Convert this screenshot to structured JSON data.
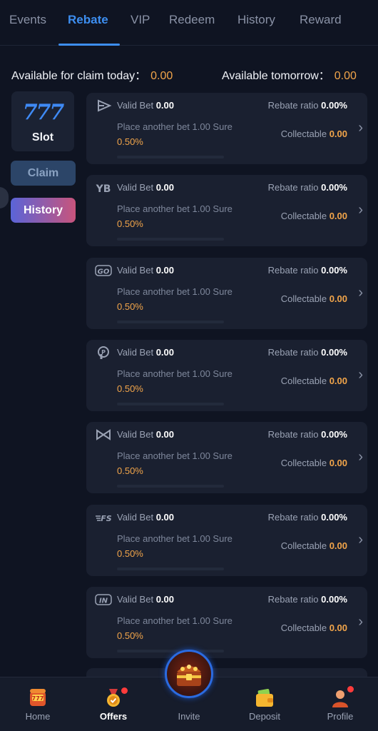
{
  "tabs": [
    "Events",
    "Rebate",
    "VIP",
    "Redeem",
    "History",
    "Reward"
  ],
  "available": {
    "today_label": "Available for claim today：",
    "today_value": "0.00",
    "tomorrow_label": "Available tomorrow：",
    "tomorrow_value": "0.00"
  },
  "category": {
    "logo": "777",
    "label": "Slot"
  },
  "buttons": {
    "claim": "Claim",
    "history": "History"
  },
  "cards": [
    {
      "provider_icon": "play-triangle-icon",
      "valid_bet_label": "Valid Bet",
      "valid_bet": "0.00",
      "rebate_label": "Rebate ratio",
      "rebate_ratio": "0.00%",
      "place_text": "Place another bet 1.00 Sure",
      "percent": "0.50%",
      "collectable_label": "Collectable",
      "collectable": "0.00"
    },
    {
      "provider_icon": "yb-provider-icon",
      "valid_bet_label": "Valid Bet",
      "valid_bet": "0.00",
      "rebate_label": "Rebate ratio",
      "rebate_ratio": "0.00%",
      "place_text": "Place another bet 1.00 Sure",
      "percent": "0.50%",
      "collectable_label": "Collectable",
      "collectable": "0.00"
    },
    {
      "provider_icon": "go-provider-icon",
      "valid_bet_label": "Valid Bet",
      "valid_bet": "0.00",
      "rebate_label": "Rebate ratio",
      "rebate_ratio": "0.00%",
      "place_text": "Place another bet 1.00 Sure",
      "percent": "0.50%",
      "collectable_label": "Collectable",
      "collectable": "0.00"
    },
    {
      "provider_icon": "pg-provider-icon",
      "valid_bet_label": "Valid Bet",
      "valid_bet": "0.00",
      "rebate_label": "Rebate ratio",
      "rebate_ratio": "0.00%",
      "place_text": "Place another bet 1.00 Sure",
      "percent": "0.50%",
      "collectable_label": "Collectable",
      "collectable": "0.00"
    },
    {
      "provider_icon": "bow-tie-provider-icon",
      "valid_bet_label": "Valid Bet",
      "valid_bet": "0.00",
      "rebate_label": "Rebate ratio",
      "rebate_ratio": "0.00%",
      "place_text": "Place another bet 1.00 Sure",
      "percent": "0.50%",
      "collectable_label": "Collectable",
      "collectable": "0.00"
    },
    {
      "provider_icon": "fs-provider-icon",
      "valid_bet_label": "Valid Bet",
      "valid_bet": "0.00",
      "rebate_label": "Rebate ratio",
      "rebate_ratio": "0.00%",
      "place_text": "Place another bet 1.00 Sure",
      "percent": "0.50%",
      "collectable_label": "Collectable",
      "collectable": "0.00"
    },
    {
      "provider_icon": "in-provider-icon",
      "valid_bet_label": "Valid Bet",
      "valid_bet": "0.00",
      "rebate_label": "Rebate ratio",
      "rebate_ratio": "0.00%",
      "place_text": "Place another bet 1.00 Sure",
      "percent": "0.50%",
      "collectable_label": "Collectable",
      "collectable": "0.00"
    }
  ],
  "bottom_nav": [
    {
      "label": "Home",
      "icon": "slot-machine-icon"
    },
    {
      "label": "Offers",
      "icon": "medal-icon"
    },
    {
      "label": "Invite",
      "icon": "treasure-chest-icon"
    },
    {
      "label": "Deposit",
      "icon": "wallet-icon"
    },
    {
      "label": "Profile",
      "icon": "avatar-icon"
    }
  ],
  "colors": {
    "accent": "#3d8ef0",
    "amount": "#f2a54a",
    "background": "#0f1422",
    "card": "#1a2030"
  }
}
